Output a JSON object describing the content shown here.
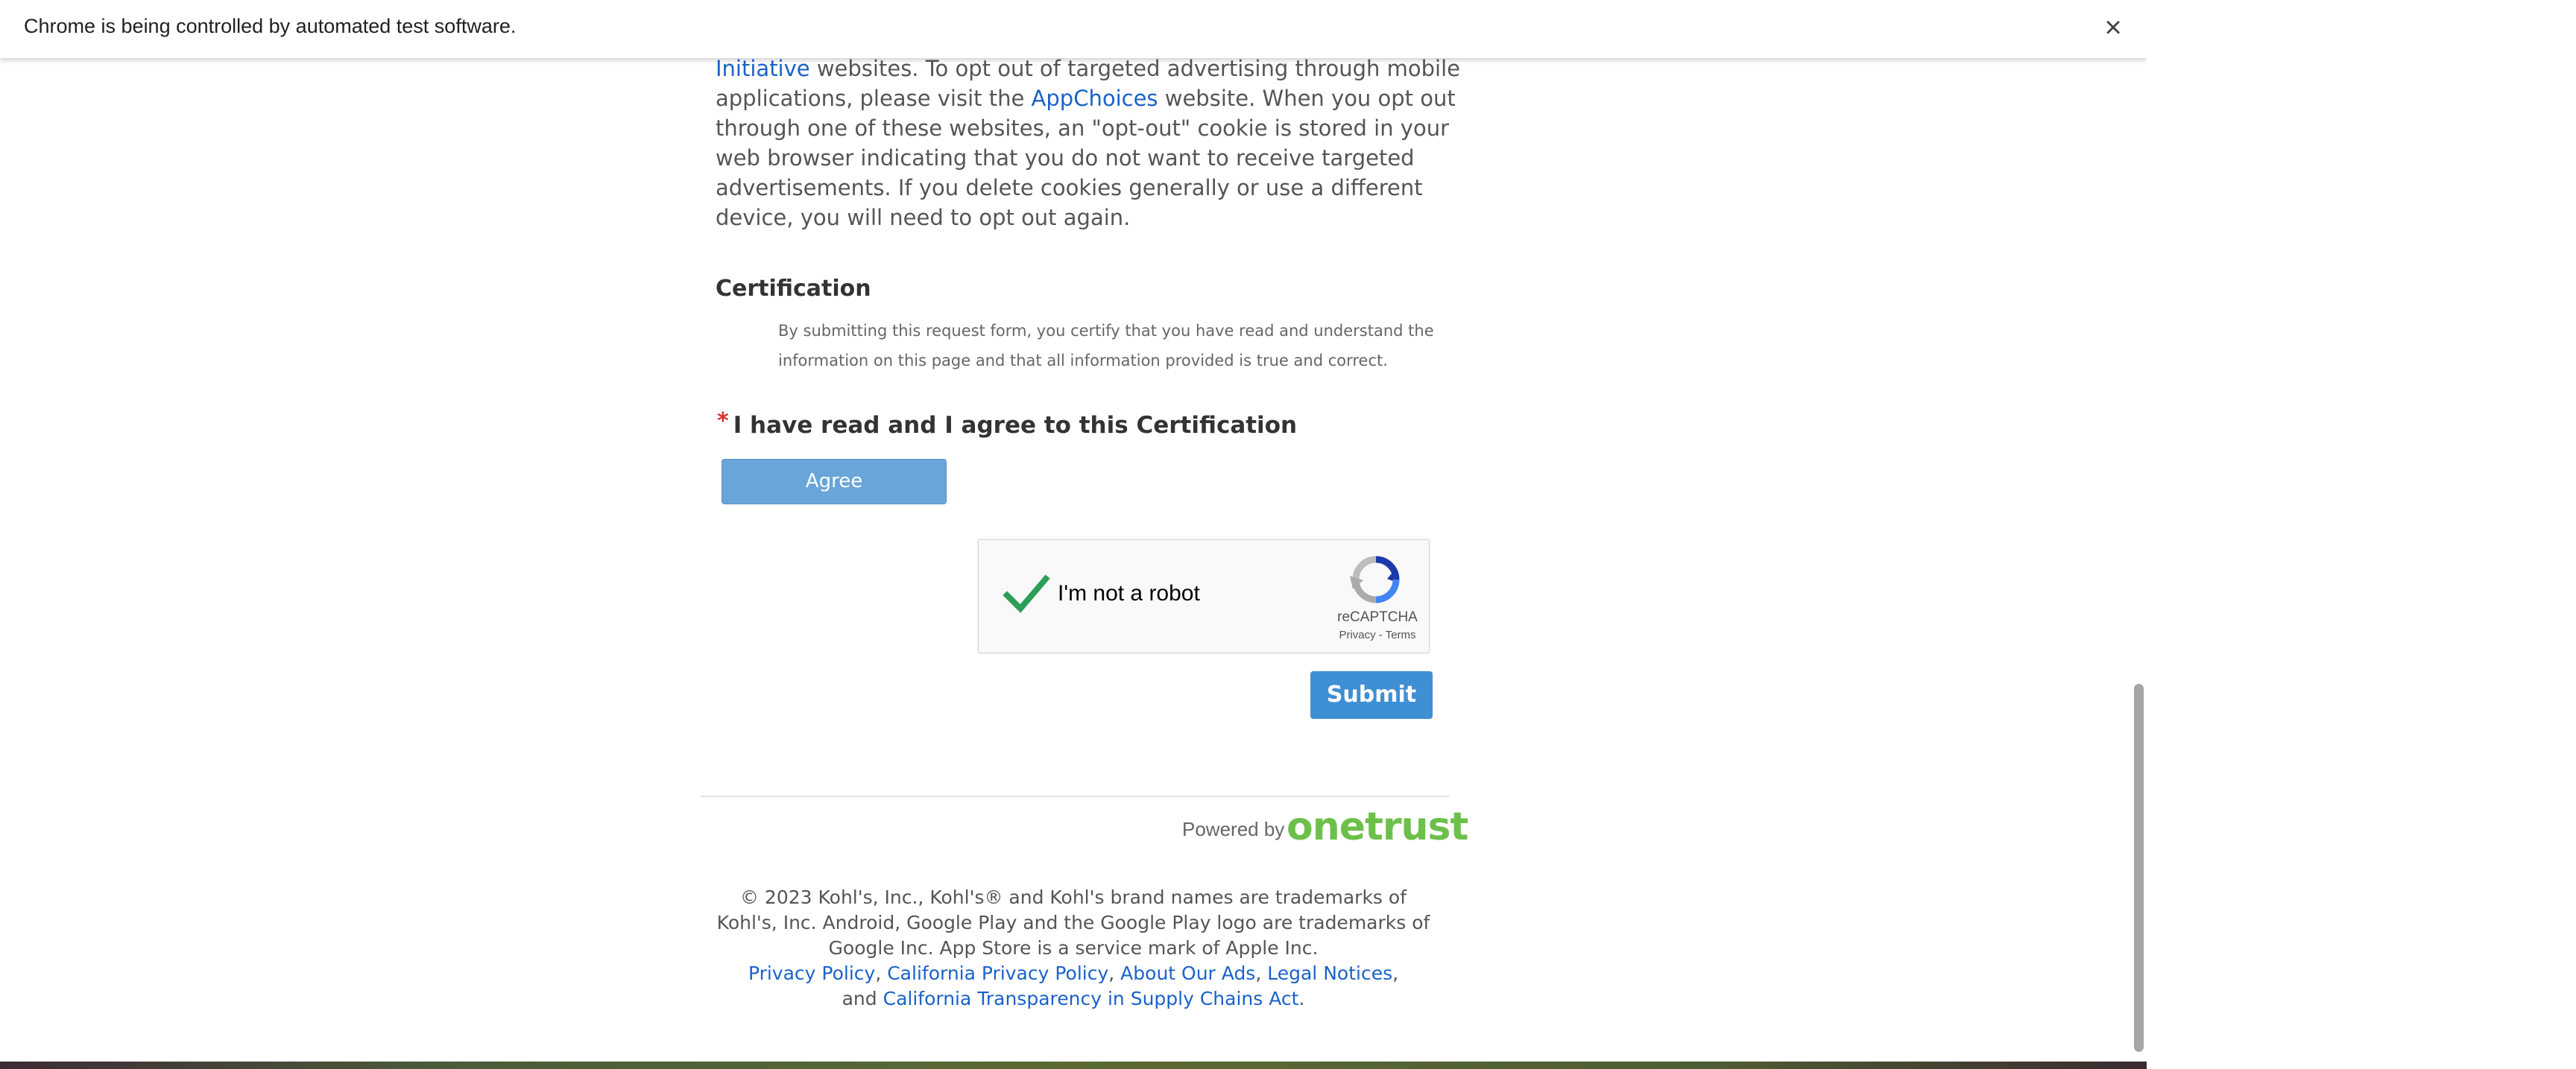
{
  "browser": {
    "infobar_text": "Chrome is being controlled by automated test software.",
    "close_glyph": "×"
  },
  "privacy": {
    "top_link": "Initiative",
    "text_1": " websites. To opt out of targeted advertising through mobile applications, please visit the ",
    "appchoices_link": "AppChoices",
    "text_2": " website. When you opt out through one of these websites, an \"opt-out\" cookie is stored in your web browser indicating that you do not want to receive targeted advertisements. If you delete cookies generally or use a different device, you will need to opt out again."
  },
  "certification": {
    "heading": "Certification",
    "description": "By submitting this request form, you certify that you have read and understand the information on this page and that all information provided is true and correct.",
    "required_marker": "*",
    "agree_label": "I have read and I agree to this Certification",
    "agree_button": "Agree"
  },
  "recaptcha": {
    "label": "I'm not a robot",
    "brand": "reCAPTCHA",
    "privacy_link": "Privacy",
    "separator": " - ",
    "terms_link": "Terms",
    "checked": true
  },
  "form": {
    "submit_button": "Submit"
  },
  "footer": {
    "powered_by": "Powered by",
    "onetrust": "onetrust",
    "copyright": "© 2023 Kohl's, Inc., Kohl's® and Kohl's brand names are trademarks of Kohl's, Inc. Android, Google Play and the Google Play logo are trademarks of Google Inc. App Store is a service mark of Apple Inc.",
    "links": {
      "privacy_policy": "Privacy Policy",
      "california_privacy_policy": "California Privacy Policy",
      "about_our_ads": "About Our Ads",
      "legal_notices": "Legal Notices",
      "and_text": "and",
      "california_transparency": "California Transparency in Supply Chains Act",
      "sep": ", ",
      "end": "."
    }
  },
  "colors": {
    "link": "#1a62c9",
    "agree_button": "#6aa5d9",
    "submit_button": "#3f8fd4",
    "onetrust_green": "#6cc04a",
    "required": "#d9312c",
    "checkmark": "#2d9e57"
  }
}
